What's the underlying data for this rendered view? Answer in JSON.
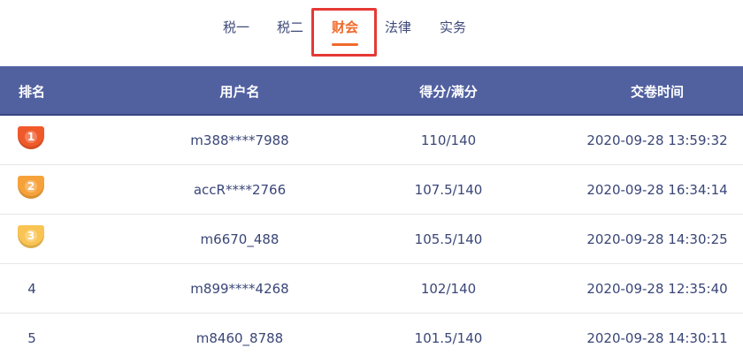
{
  "tabs": [
    {
      "label": "税一",
      "active": false
    },
    {
      "label": "税二",
      "active": false
    },
    {
      "label": "财会",
      "active": true
    },
    {
      "label": "法律",
      "active": false
    },
    {
      "label": "实务",
      "active": false
    }
  ],
  "table": {
    "headers": {
      "rank": "排名",
      "username": "用户名",
      "score": "得分/满分",
      "submit_time": "交卷时间"
    },
    "rows": [
      {
        "rank": "1",
        "username": "m388****7988",
        "score": "110/140",
        "submit_time": "2020-09-28 13:59:32"
      },
      {
        "rank": "2",
        "username": "accR****2766",
        "score": "107.5/140",
        "submit_time": "2020-09-28 16:34:14"
      },
      {
        "rank": "3",
        "username": "m6670_488",
        "score": "105.5/140",
        "submit_time": "2020-09-28 14:30:25"
      },
      {
        "rank": "4",
        "username": "m899****4268",
        "score": "102/140",
        "submit_time": "2020-09-28 12:35:40"
      },
      {
        "rank": "5",
        "username": "m8460_8788",
        "score": "101.5/140",
        "submit_time": "2020-09-28 14:30:11"
      }
    ]
  },
  "colors": {
    "header_bg": "#5161a0",
    "accent": "#f06a2a",
    "highlight_box": "#e53935",
    "medal_gold": "#f0592a",
    "medal_silver": "#f6a23a",
    "medal_bronze": "#f9c454"
  }
}
